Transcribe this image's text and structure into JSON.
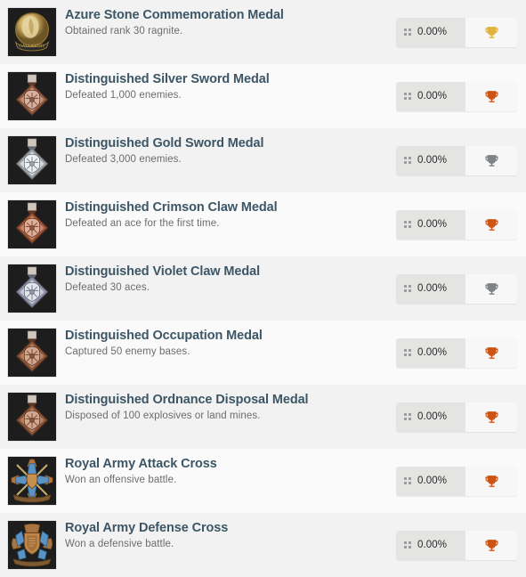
{
  "colors": {
    "title": "#3d5666",
    "description": "#6c6c6c",
    "row_alt_bg": "#f2f2f2",
    "row_plain_bg": "#fafafa",
    "badge_progress_bg": "#e4e5e2",
    "badge_trophy_bg": "#f7f7f7",
    "trophy_gold": "#e0b33c",
    "trophy_silver": "#7d8287",
    "trophy_bronze": "#cc5516"
  },
  "achievements": [
    {
      "title": "Azure Stone Commemoration Medal",
      "description": "Obtained rank 30 ragnite.",
      "progress": "0.00%",
      "trophy": "trophy-icon-gold",
      "trophy_color": "#e0b33c",
      "medal": "round-gold-medal",
      "icon_grip": "grip-dots-icon"
    },
    {
      "title": "Distinguished Silver Sword Medal",
      "description": "Defeated 1,000 enemies.",
      "progress": "0.00%",
      "trophy": "trophy-icon-bronze",
      "trophy_color": "#cc5516",
      "medal": "diamond-copper-medal",
      "icon_grip": "grip-dots-icon"
    },
    {
      "title": "Distinguished Gold Sword Medal",
      "description": "Defeated 3,000 enemies.",
      "progress": "0.00%",
      "trophy": "trophy-icon-silver",
      "trophy_color": "#7d8287",
      "medal": "diamond-silver-medal",
      "icon_grip": "grip-dots-icon"
    },
    {
      "title": "Distinguished Crimson Claw Medal",
      "description": "Defeated an ace for the first time.",
      "progress": "0.00%",
      "trophy": "trophy-icon-bronze",
      "trophy_color": "#cc5516",
      "medal": "diamond-crimson-medal",
      "icon_grip": "grip-dots-icon"
    },
    {
      "title": "Distinguished Violet Claw Medal",
      "description": "Defeated 30 aces.",
      "progress": "0.00%",
      "trophy": "trophy-icon-silver",
      "trophy_color": "#7d8287",
      "medal": "diamond-violet-medal",
      "icon_grip": "grip-dots-icon"
    },
    {
      "title": "Distinguished Occupation Medal",
      "description": "Captured 50 enemy bases.",
      "progress": "0.00%",
      "trophy": "trophy-icon-bronze",
      "trophy_color": "#cc5516",
      "medal": "diamond-bronze-medal",
      "icon_grip": "grip-dots-icon"
    },
    {
      "title": "Distinguished Ordnance Disposal Medal",
      "description": "Disposed of 100 explosives or land mines.",
      "progress": "0.00%",
      "trophy": "trophy-icon-bronze",
      "trophy_color": "#cc5516",
      "medal": "diamond-bronze-medal",
      "icon_grip": "grip-dots-icon"
    },
    {
      "title": "Royal Army Attack Cross",
      "description": "Won an offensive battle.",
      "progress": "0.00%",
      "trophy": "trophy-icon-bronze",
      "trophy_color": "#cc5516",
      "medal": "blue-cross-swords-medal",
      "icon_grip": "grip-dots-icon"
    },
    {
      "title": "Royal Army Defense Cross",
      "description": "Won a defensive battle.",
      "progress": "0.00%",
      "trophy": "trophy-icon-bronze",
      "trophy_color": "#cc5516",
      "medal": "blue-cross-shield-medal",
      "icon_grip": "grip-dots-icon"
    }
  ]
}
